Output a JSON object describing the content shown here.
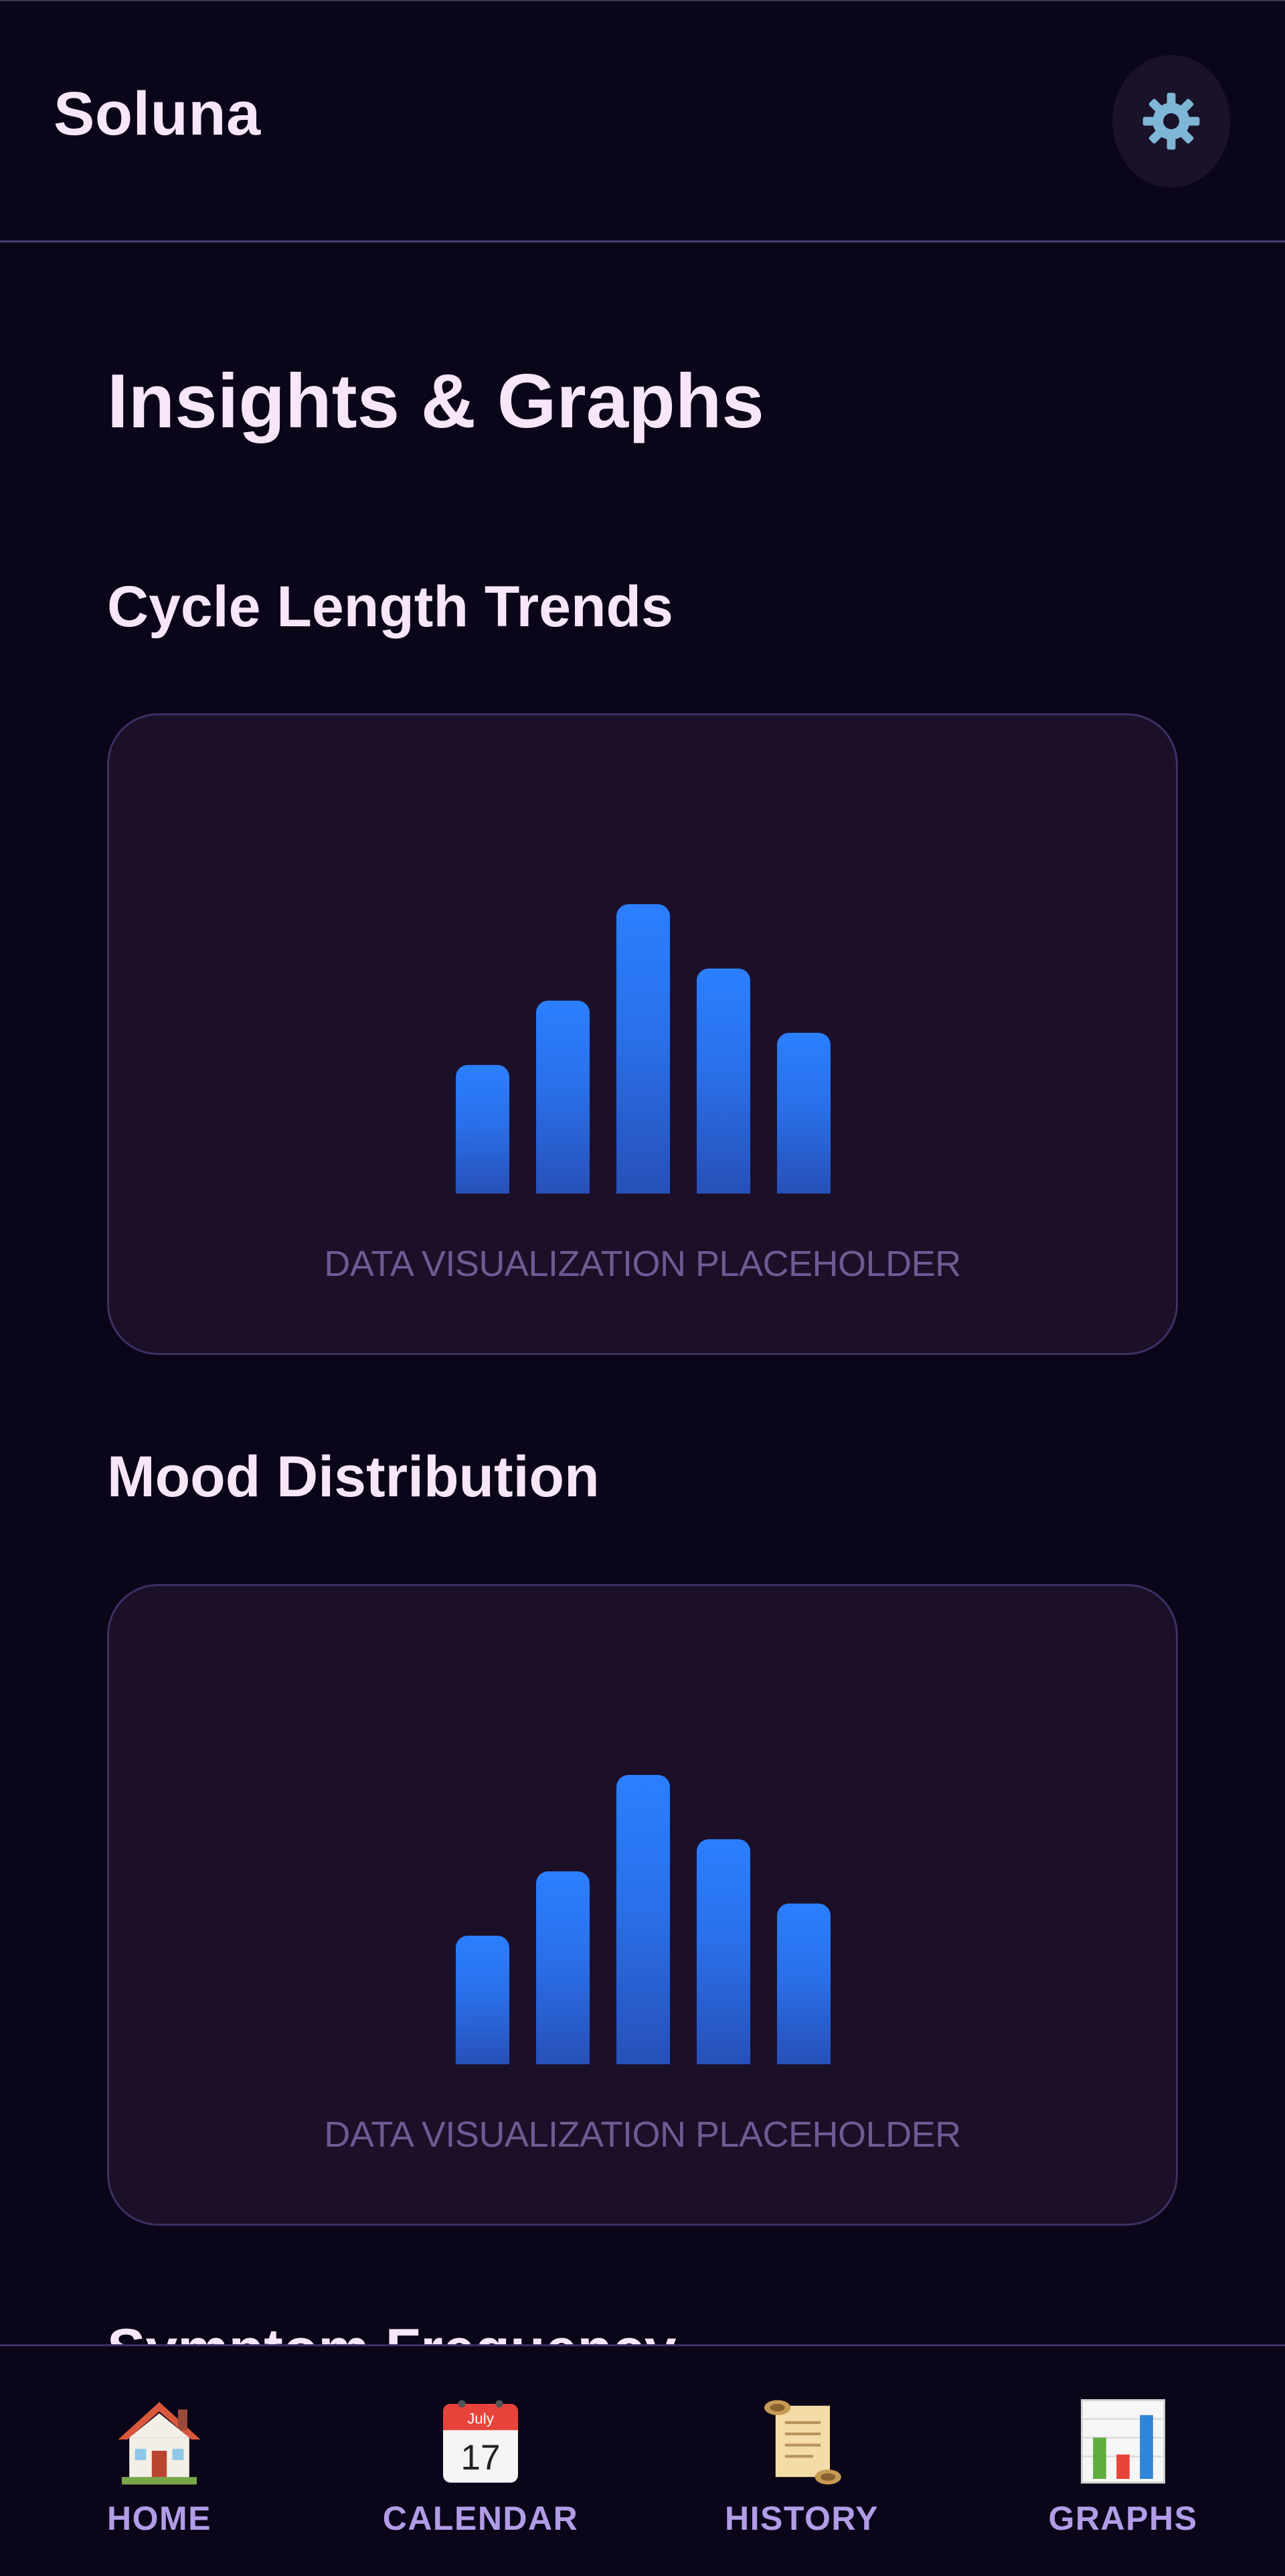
{
  "header": {
    "app_title": "Soluna",
    "settings_icon": "gear-icon"
  },
  "main": {
    "page_title": "Insights & Graphs",
    "sections": [
      {
        "title": "Cycle Length Trends",
        "placeholder_text": "DATA VISUALIZATION PLACEHOLDER"
      },
      {
        "title": "Mood Distribution",
        "placeholder_text": "DATA VISUALIZATION PLACEHOLDER"
      },
      {
        "title": "Symptom Frequency"
      }
    ]
  },
  "chart_data": [
    {
      "type": "bar",
      "values": [
        40,
        60,
        90,
        70,
        50
      ]
    },
    {
      "type": "bar",
      "values": [
        40,
        60,
        90,
        70,
        50
      ]
    }
  ],
  "bottom_nav": {
    "items": [
      {
        "label": "HOME",
        "icon": "house-icon"
      },
      {
        "label": "CALENDAR",
        "icon": "calendar-icon",
        "icon_text_month": "July",
        "icon_text_day": "17"
      },
      {
        "label": "HISTORY",
        "icon": "scroll-icon"
      },
      {
        "label": "GRAPHS",
        "icon": "bar-chart-icon"
      }
    ]
  },
  "colors": {
    "background": "#0b0519",
    "card": "#1c1029",
    "card_border": "#3d3063",
    "bar_accent": "#2b7fff",
    "nav_label": "#b29ce6",
    "title_text": "#f6e6f8",
    "placeholder_text": "#6f5a93"
  }
}
